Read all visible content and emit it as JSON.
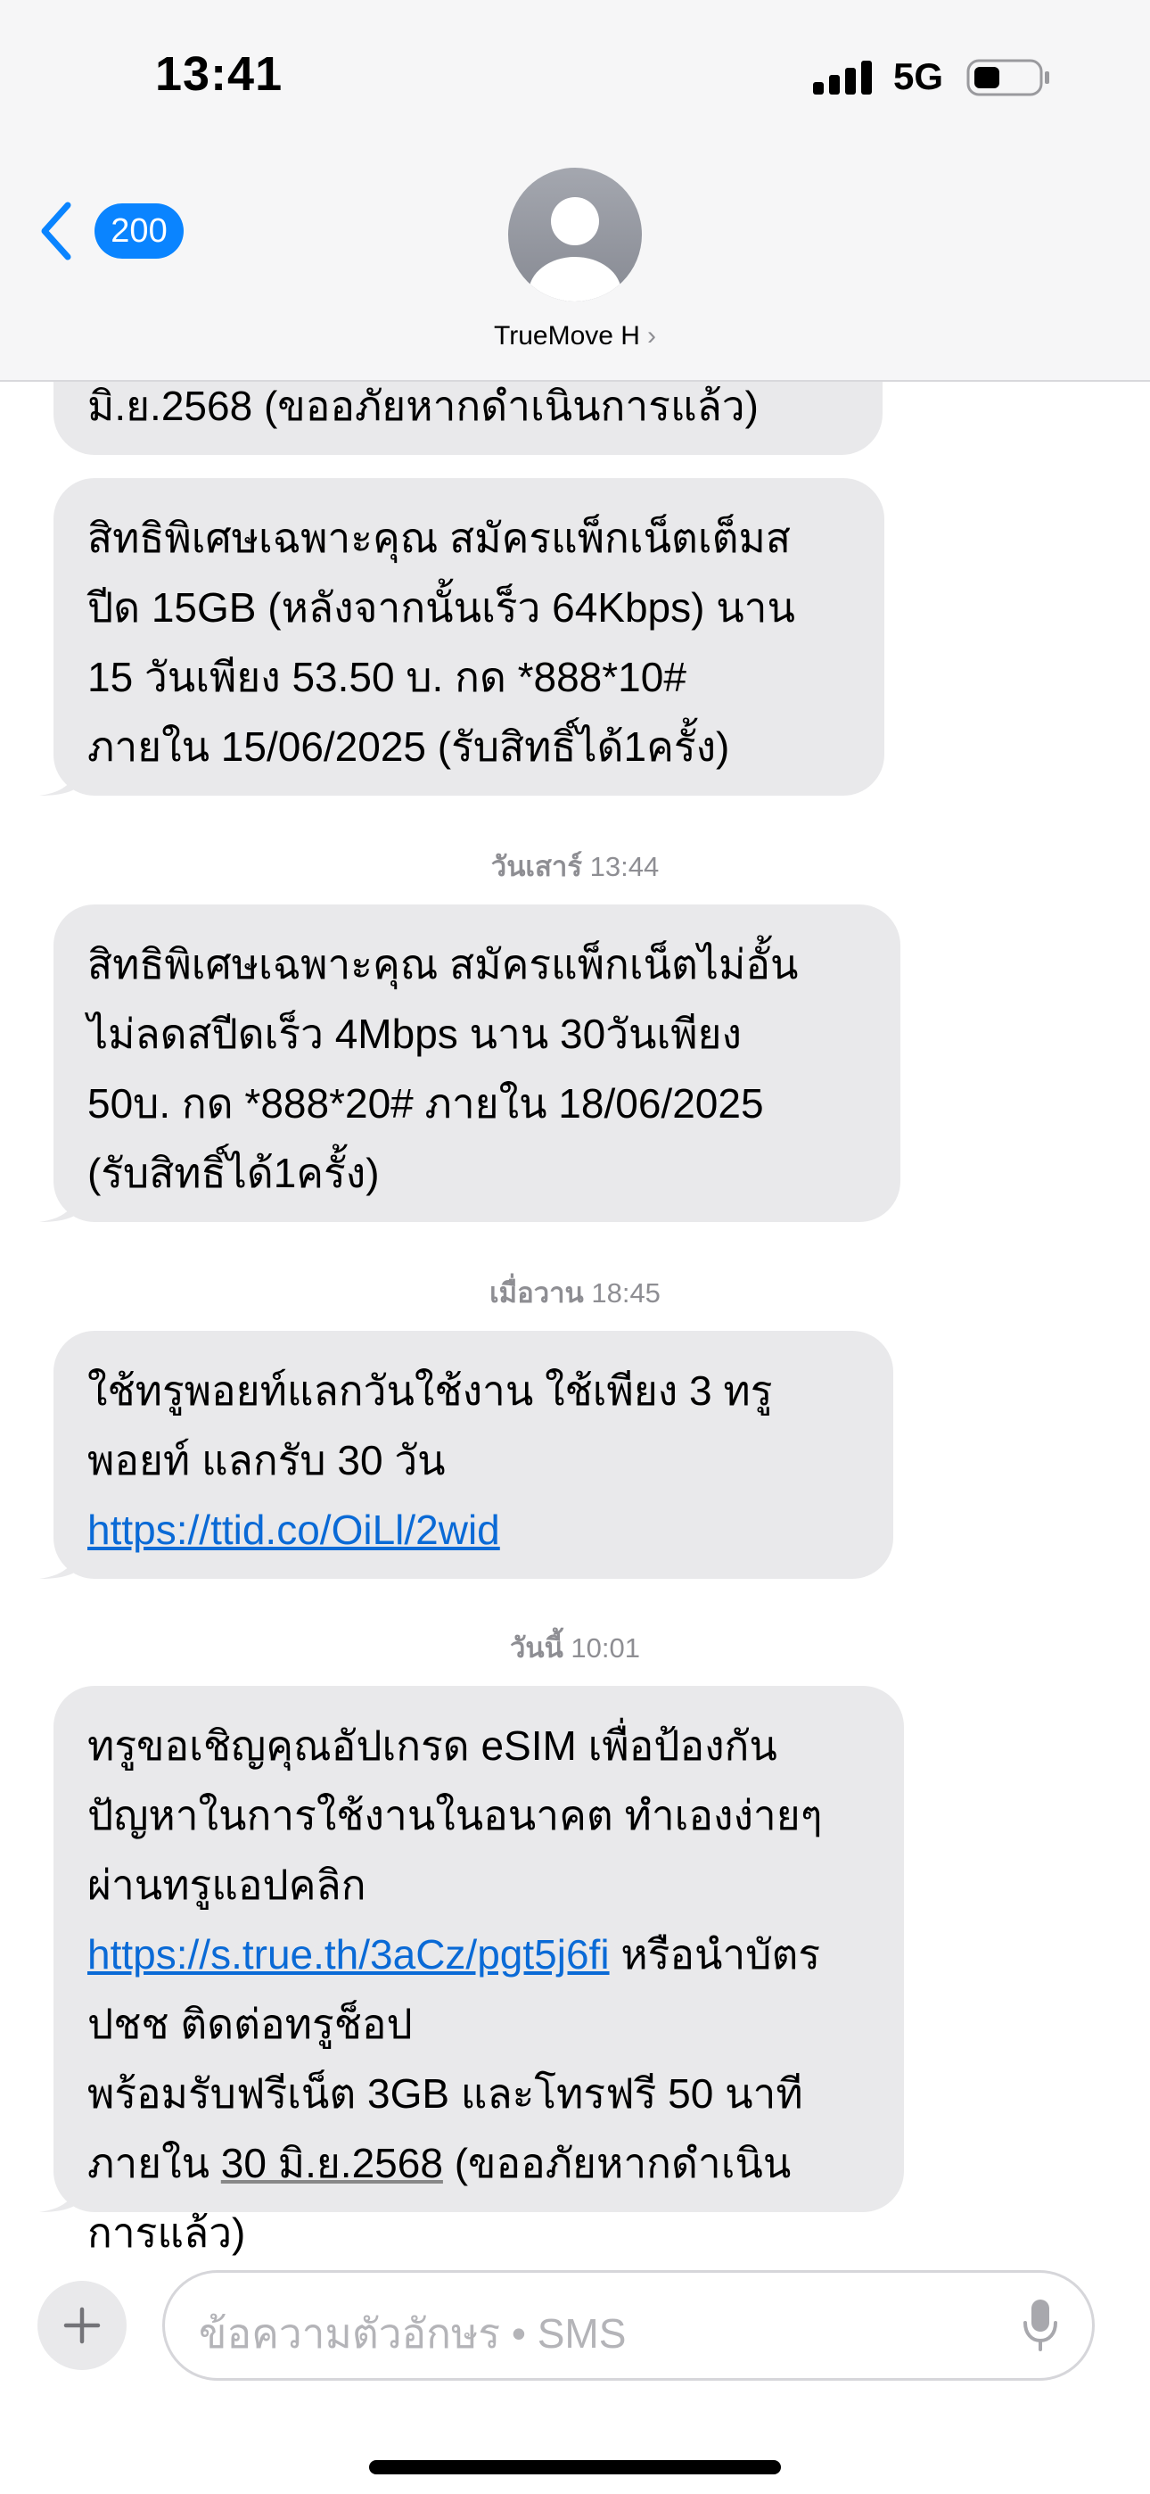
{
  "status_bar": {
    "time": "13:41",
    "network": "5G"
  },
  "header": {
    "back_count": "200",
    "contact_name": "TrueMove H",
    "contact_chevron": "›"
  },
  "messages": [
    {
      "partial_text": "มิ.ย.2568 (ขออภัยหากดำเนินการแล้ว)"
    },
    {
      "text": "สิทธิพิเศษเฉพาะคุณ สมัครแพ็กเน็ตเต็มส\nปีด 15GB (หลังจากนั้นเร็ว 64Kbps) นาน\n15 วันเพียง 53.50 บ. กด *888*10#\nภายใน 15/06/2025 (รับสิทธิ์ได้1ครั้ง)"
    },
    {
      "stamp_day": "วันเสาร์",
      "stamp_time": "13:44",
      "text": "สิทธิพิเศษเฉพาะคุณ สมัครแพ็กเน็ตไม่อั้น\nไม่ลดสปีดเร็ว 4Mbps นาน 30วันเพียง\n50บ. กด *888*20# ภายใน 18/06/2025\n(รับสิทธิ์ได้1ครั้ง)"
    },
    {
      "stamp_day": "เมื่อวาน",
      "stamp_time": "18:45",
      "text_1": "ใช้ทรูพอยท์แลกวันใช้งาน ใช้เพียง 3 ทรู\nพอยท์ แลกรับ 30 วัน ",
      "link": "https://ttid.co/OiLl/2wid"
    },
    {
      "stamp_day": "วันนี้",
      "stamp_time": "10:01",
      "text_1": "ทรูขอเชิญคุณอัปเกรด eSIM เพื่อป้องกัน\nปัญหาในการใช้งานในอนาคต ทำเองง่ายๆ\nผ่านทรูแอปคลิก ",
      "link": "https://s.true.th/3aCz/pgt5j6fi",
      "text_2": " หรือนำบัตร ปชช ติดต่อทรูช็อป\nพร้อมรับฟรีเน็ต 3GB และโทรฟรี 50 นาที\nภายใน ",
      "date_link": "30 มิ.ย.2568",
      "text_3": " (ขออภัยหากดำเนิน\nการแล้ว)"
    }
  ],
  "composer": {
    "placeholder": "ข้อความตัวอักษร • SMS"
  },
  "icons": {
    "back": "chevron-left-icon",
    "avatar": "person-icon",
    "plus": "plus-icon",
    "mic": "microphone-icon",
    "signal": "cellular-signal-icon",
    "battery": "battery-icon"
  },
  "colors": {
    "accent": "#0a84ff",
    "bubble": "#e9e9eb",
    "link": "#0a6ad6"
  }
}
